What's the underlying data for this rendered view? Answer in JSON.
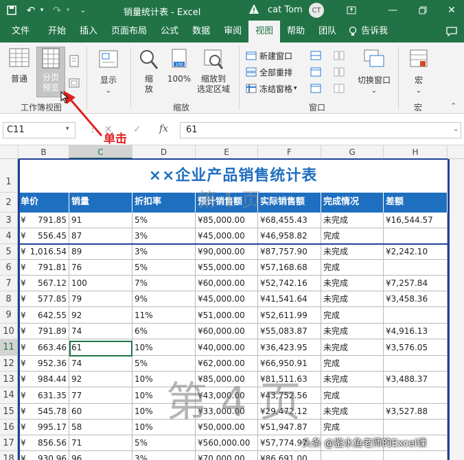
{
  "title_bar": {
    "doc_title": "销量统计表 - Excel",
    "user": "cat Tom",
    "avatar_initials": "CT"
  },
  "menu_tabs": [
    "文件",
    "开始",
    "插入",
    "页面布局",
    "公式",
    "数据",
    "审阅",
    "视图",
    "帮助",
    "团队",
    "告诉我"
  ],
  "active_tab": "视图",
  "ribbon": {
    "normal": "普通",
    "page_break_line1": "分页",
    "page_break_line2": "预览",
    "show": "显示",
    "zoom_line1": "缩",
    "zoom_line2": "放",
    "zoom_100": "100%",
    "zoom_selection_line1": "缩放到",
    "zoom_selection_line2": "选定区域",
    "new_window": "新建窗口",
    "arrange_all": "全部重排",
    "freeze_panes": "冻结窗格",
    "switch_window": "切换窗口",
    "macro": "宏",
    "group_workbook_views": "工作簿视图",
    "group_zoom": "缩放",
    "group_window": "窗口",
    "group_macro": "宏"
  },
  "formula_bar": {
    "name_box": "C11",
    "fx": "fx",
    "content": "61"
  },
  "columns": [
    "B",
    "C",
    "D",
    "E",
    "F",
    "G",
    "H"
  ],
  "selected_column": "C",
  "rows": [
    "1",
    "2",
    "3",
    "4",
    "5",
    "6",
    "7",
    "8",
    "9",
    "10",
    "11",
    "12",
    "13",
    "14",
    "15",
    "16",
    "17",
    "18"
  ],
  "selected_row": "11",
  "sheet_title": "××企业产品销售统计表",
  "table_headers": [
    "单价",
    "销量",
    "折扣率",
    "预计销售额",
    "实际销售额",
    "完成情况",
    "差额"
  ],
  "table_rows": [
    [
      "791.85",
      "91",
      "5%",
      "¥85,000.00",
      "¥68,455.43",
      "未完成",
      "¥16,544.57"
    ],
    [
      "556.45",
      "87",
      "3%",
      "¥45,000.00",
      "¥46,958.82",
      "完成",
      ""
    ],
    [
      "1,016.54",
      "89",
      "3%",
      "¥90,000.00",
      "¥87,757.90",
      "未完成",
      "¥2,242.10"
    ],
    [
      "791.81",
      "76",
      "5%",
      "¥55,000.00",
      "¥57,168.68",
      "完成",
      ""
    ],
    [
      "567.12",
      "100",
      "7%",
      "¥60,000.00",
      "¥52,742.16",
      "未完成",
      "¥7,257.84"
    ],
    [
      "577.85",
      "79",
      "9%",
      "¥45,000.00",
      "¥41,541.64",
      "未完成",
      "¥3,458.36"
    ],
    [
      "642.55",
      "92",
      "11%",
      "¥51,000.00",
      "¥52,611.99",
      "完成",
      ""
    ],
    [
      "791.89",
      "74",
      "6%",
      "¥60,000.00",
      "¥55,083.87",
      "未完成",
      "¥4,916.13"
    ],
    [
      "663.46",
      "61",
      "10%",
      "¥40,000.00",
      "¥36,423.95",
      "未完成",
      "¥3,576.05"
    ],
    [
      "952.36",
      "74",
      "5%",
      "¥62,000.00",
      "¥66,950.91",
      "完成",
      ""
    ],
    [
      "984.44",
      "92",
      "10%",
      "¥85,000.00",
      "¥81,511.63",
      "未完成",
      "¥3,488.37"
    ],
    [
      "631.35",
      "77",
      "10%",
      "¥43,000.00",
      "¥43,752.56",
      "完成",
      ""
    ],
    [
      "545.78",
      "60",
      "10%",
      "¥33,000.00",
      "¥29,472.12",
      "未完成",
      "¥3,527.88"
    ],
    [
      "995.17",
      "58",
      "10%",
      "¥50,000.00",
      "¥51,947.87",
      "完成",
      ""
    ],
    [
      "856.56",
      "71",
      "5%",
      "¥560,000.00",
      "¥57,774.97",
      "",
      ""
    ],
    [
      "930.96",
      "96",
      "3%",
      "¥70,000.00",
      "¥86,691.00",
      "",
      ""
    ]
  ],
  "currency_symbol": "¥",
  "watermark_page1": "第 1 页",
  "watermark_page4": "第 4 页",
  "annotation": "单击",
  "credit": "头条 @鉴水鱼老师的Excel课",
  "colors": {
    "excel_green": "#217346",
    "header_blue": "#1f6fc0",
    "annotation_red": "#e02020",
    "page_break": "#1f3f99"
  }
}
